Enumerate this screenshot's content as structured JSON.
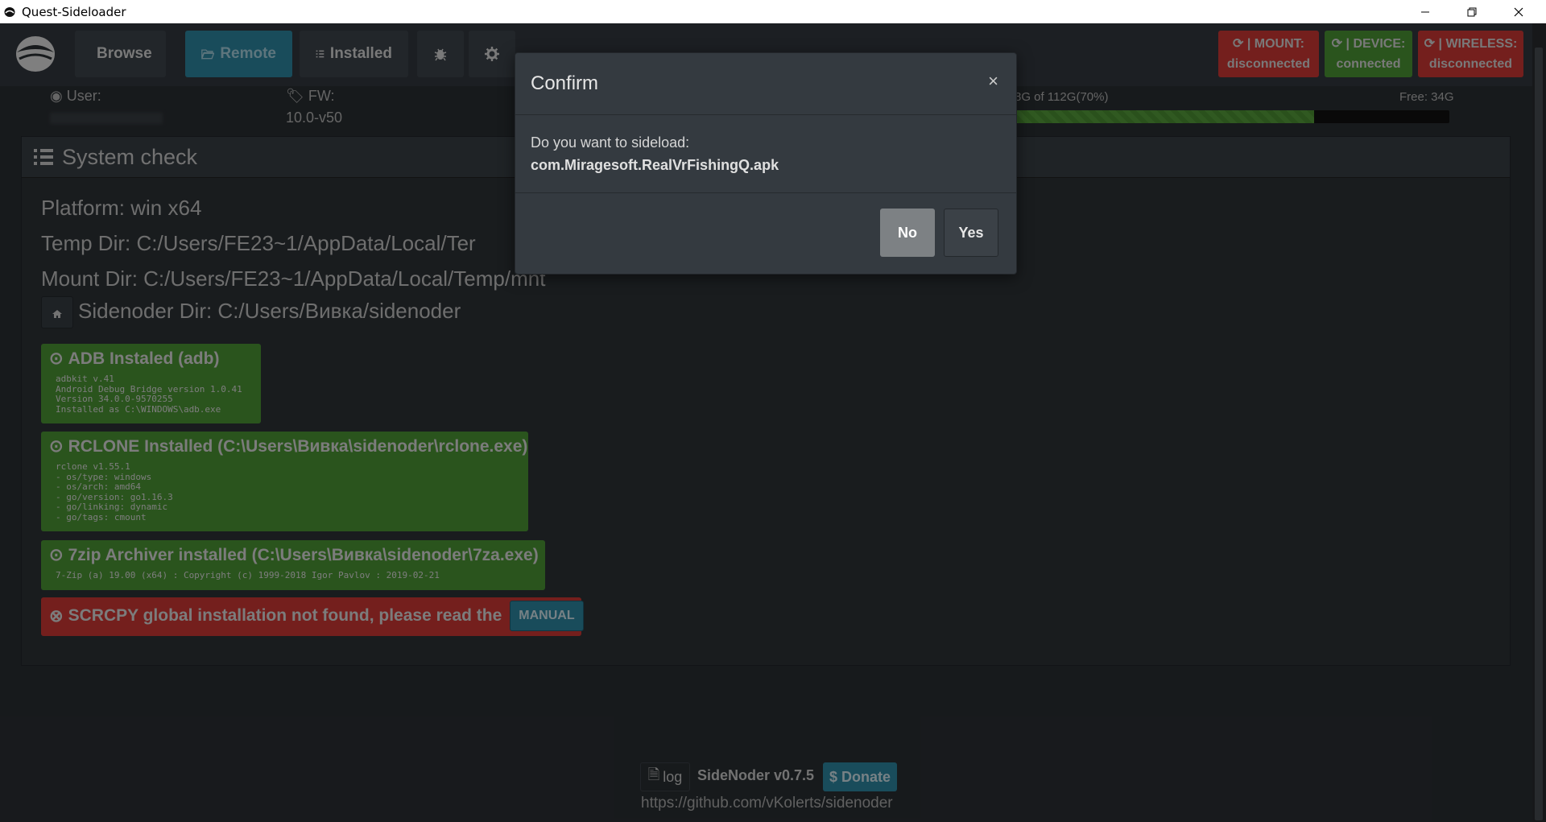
{
  "window": {
    "title": "Quest-Sideloader"
  },
  "nav": {
    "browse": "Browse",
    "remote": "Remote",
    "installed": "Installed"
  },
  "status": {
    "mount_label": "| MOUNT:",
    "mount_value": "disconnected",
    "device_label": "| DEVICE:",
    "device_value": "connected",
    "wireless_label": "| WIRELESS:",
    "wireless_value": "disconnected"
  },
  "info": {
    "user_label": "User:",
    "fw_label": "FW:",
    "fw_value": "10.0-v50",
    "storage_used": "l: 78G of 112G(70%)",
    "storage_free": "Free: 34G",
    "storage_fraction": 0.7
  },
  "system_check": {
    "title": "System check",
    "platform": "Platform: win x64",
    "temp_dir": "Temp Dir: C:/Users/FE23~1/AppData/Local/Ter",
    "mount_dir": "Mount Dir: C:/Users/FE23~1/AppData/Local/Temp/mnt",
    "sidenoder_dir": "Sidenoder Dir: C:/Users/Вивка/sidenoder",
    "adb": {
      "title": "ADB Instaled (adb)",
      "details": "adbkit v.41\nAndroid Debug Bridge version 1.0.41\nVersion 34.0.0-9570255\nInstalled as C:\\WINDOWS\\adb.exe"
    },
    "rclone": {
      "title": "RCLONE Installed (C:\\Users\\Вивка\\sidenoder\\rclone.exe)",
      "details": "rclone v1.55.1\n- os/type: windows\n- os/arch: amd64\n- go/version: go1.16.3\n- go/linking: dynamic\n- go/tags: cmount"
    },
    "zip": {
      "title": "7zip Archiver installed (C:\\Users\\Вивка\\sidenoder\\7za.exe)",
      "details": "7-Zip (a) 19.00 (x64) : Copyright (c) 1999-2018 Igor Pavlov : 2019-02-21"
    },
    "scrcpy": {
      "title": "SCRCPY global installation not found, please read the",
      "manual": "MANUAL"
    }
  },
  "footer": {
    "log": "log",
    "version": "SideNoder v0.7.5",
    "donate": "$ Donate",
    "link": "https://github.com/vKolerts/sidenoder"
  },
  "modal": {
    "title": "Confirm",
    "close": "×",
    "question": "Do you want to sideload:",
    "file": "com.Miragesoft.RealVrFishingQ.apk",
    "no": "No",
    "yes": "Yes"
  },
  "colors": {
    "accent": "#2e8ba7",
    "success": "#4e9a36",
    "danger": "#d43a36",
    "panel": "#343a40"
  }
}
